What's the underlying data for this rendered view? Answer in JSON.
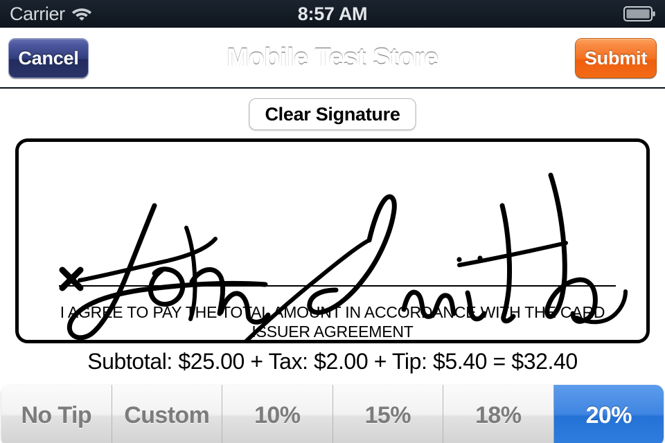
{
  "status_bar": {
    "carrier": "Carrier",
    "time": "8:57 AM",
    "wifi_icon": "wifi-icon",
    "battery_icon": "battery-icon"
  },
  "nav_bar": {
    "title": "Mobile Test Store",
    "cancel_label": "Cancel",
    "submit_label": "Submit",
    "cancel_color": "#2d3b74",
    "submit_color": "#f4701f",
    "background_color": "#1d3a55"
  },
  "toolbar": {
    "clear_signature_label": "Clear Signature"
  },
  "signature_pad": {
    "signature_name": "John Smith",
    "x_mark": "x",
    "agreement_text": "I AGREE TO PAY THE TOTAL AMOUNT IN ACCORDANCE WITH THE CARD ISSUER AGREEMENT"
  },
  "totals": {
    "line": "Subtotal: $25.00 + Tax: $2.00 + Tip: $5.40 = $32.40",
    "subtotal_label": "Subtotal:",
    "subtotal": "$25.00",
    "tax_label": "Tax:",
    "tax": "$2.00",
    "tip_label": "Tip:",
    "tip": "$5.40",
    "total": "$32.40"
  },
  "tip_control": {
    "selected_index": 5,
    "selected_color": "#2572d6",
    "segments": [
      {
        "label": "No Tip",
        "selected": false
      },
      {
        "label": "Custom",
        "selected": false
      },
      {
        "label": "10%",
        "selected": false
      },
      {
        "label": "15%",
        "selected": false
      },
      {
        "label": "18%",
        "selected": false
      },
      {
        "label": "20%",
        "selected": true
      }
    ]
  }
}
